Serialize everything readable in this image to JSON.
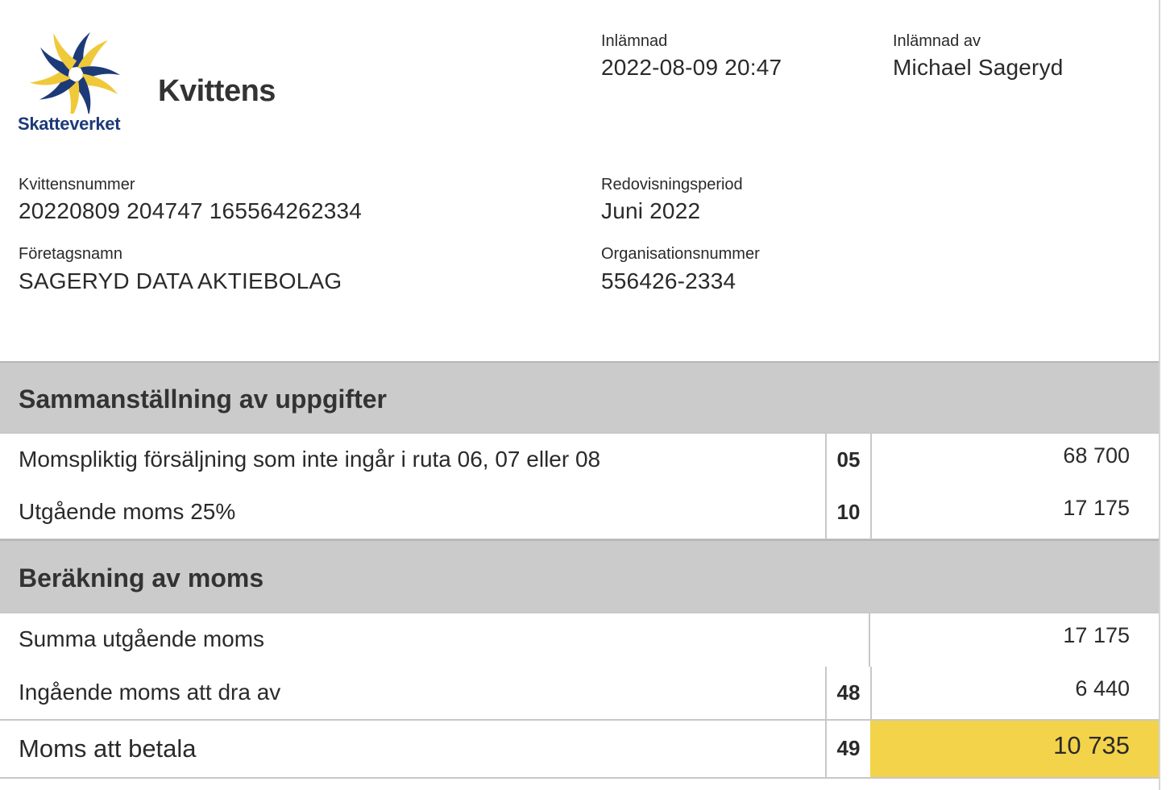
{
  "logo": {
    "text": "Skatteverket"
  },
  "title": "Kvittens",
  "meta": {
    "submitted_label": "Inlämnad",
    "submitted_value": "2022-08-09 20:47",
    "submitted_by_label": "Inlämnad av",
    "submitted_by_value": "Michael Sageryd",
    "receipt_no_label": "Kvittensnummer",
    "receipt_no_value": "20220809 204747 165564262334",
    "period_label": "Redovisningsperiod",
    "period_value": "Juni 2022",
    "company_label": "Företagsnamn",
    "company_value": "SAGERYD DATA AKTIEBOLAG",
    "orgno_label": "Organisationsnummer",
    "orgno_value": "556426-2334"
  },
  "summary": {
    "heading": "Sammanställning av uppgifter",
    "rows": [
      {
        "label": "Momspliktig försäljning som inte ingår i ruta 06, 07 eller 08",
        "code": "05",
        "amount": "68 700"
      },
      {
        "label": "Utgående moms 25%",
        "code": "10",
        "amount": "17 175"
      }
    ]
  },
  "calculation": {
    "heading": "Beräkning av moms",
    "rows": [
      {
        "label": "Summa utgående moms",
        "code": "",
        "amount": "17 175"
      },
      {
        "label": "Ingående moms att dra av",
        "code": "48",
        "amount": "6 440"
      },
      {
        "label": "Moms att betala",
        "code": "49",
        "amount": "10 735"
      }
    ]
  },
  "colors": {
    "brand_blue": "#1d3a78",
    "brand_yellow": "#f3d34a",
    "section_bg": "#cbcbcb",
    "total_highlight": "#f3d34a"
  }
}
